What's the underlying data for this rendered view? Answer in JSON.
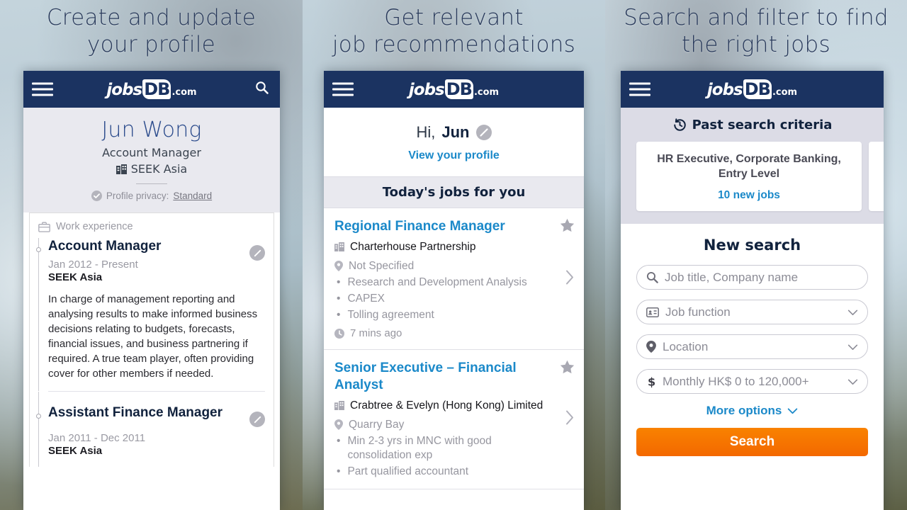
{
  "colors": {
    "navbar": "#1b3361",
    "link_blue": "#1b89c9",
    "name_blue": "#2b4b8c",
    "search_orange": "#f36800",
    "panel_grey": "#e9e9ef"
  },
  "panels": [
    {
      "heading": "Create and update\nyour profile",
      "heading_line1": "Create and update",
      "heading_line2": "your profile"
    },
    {
      "heading_line1": "Get relevant",
      "heading_line2": "job recommendations"
    },
    {
      "heading_line1": "Search and filter to find",
      "heading_line2": "the right jobs"
    }
  ],
  "brand": {
    "part1": "jobs",
    "part2": "DB",
    "part3": ".com"
  },
  "profile": {
    "name": "Jun Wong",
    "role": "Account Manager",
    "company": "SEEK Asia",
    "privacy_label": "Profile privacy:",
    "privacy_value": "Standard",
    "work_experience_label": "Work experience",
    "experiences": [
      {
        "title": "Account Manager",
        "dates": "Jan 2012 - Present",
        "org": "SEEK Asia",
        "description": "In charge of management reporting and analysing results to make informed business decisions relating to budgets, forecasts, financial issues, and business partnering if required.  A true team player, often providing cover for other members if needed."
      },
      {
        "title": "Assistant Finance Manager",
        "dates": "Jan 2011 - Dec 2011",
        "org": "SEEK Asia",
        "description": ""
      }
    ]
  },
  "recommendations": {
    "greeting_prefix": "Hi,",
    "greeting_name": "Jun",
    "view_profile_link": "View your profile",
    "section_title": "Today's jobs for you",
    "jobs": [
      {
        "title": "Regional Finance Manager",
        "company": "Charterhouse Partnership",
        "location": "Not Specified",
        "bullets": [
          "Research and Development Analysis",
          "CAPEX",
          "Tolling agreement"
        ],
        "posted": "7 mins ago"
      },
      {
        "title": "Senior Executive – Financial Analyst",
        "company": "Crabtree & Evelyn (Hong Kong) Limited",
        "location": "Quarry Bay",
        "bullets": [
          "Min 2-3 yrs in MNC with good consolidation exp",
          "Part qualified accountant"
        ],
        "posted": ""
      }
    ]
  },
  "search": {
    "past_search_title": "Past search criteria",
    "past_cards": [
      {
        "criteria": "HR Executive, Corporate Banking, Entry Level",
        "new_jobs": "10 new jobs"
      }
    ],
    "new_search_title": "New search",
    "fields": [
      {
        "icon": "search-icon",
        "placeholder": "Job title, Company name",
        "caret": false
      },
      {
        "icon": "job-function-icon",
        "placeholder": "Job function",
        "caret": true
      },
      {
        "icon": "location-pin-icon",
        "placeholder": "Location",
        "caret": true
      },
      {
        "icon": "dollar-icon",
        "placeholder": "Monthly HK$ 0 to 120,000+",
        "caret": true
      }
    ],
    "more_options_label": "More options",
    "search_button_label": "Search"
  }
}
